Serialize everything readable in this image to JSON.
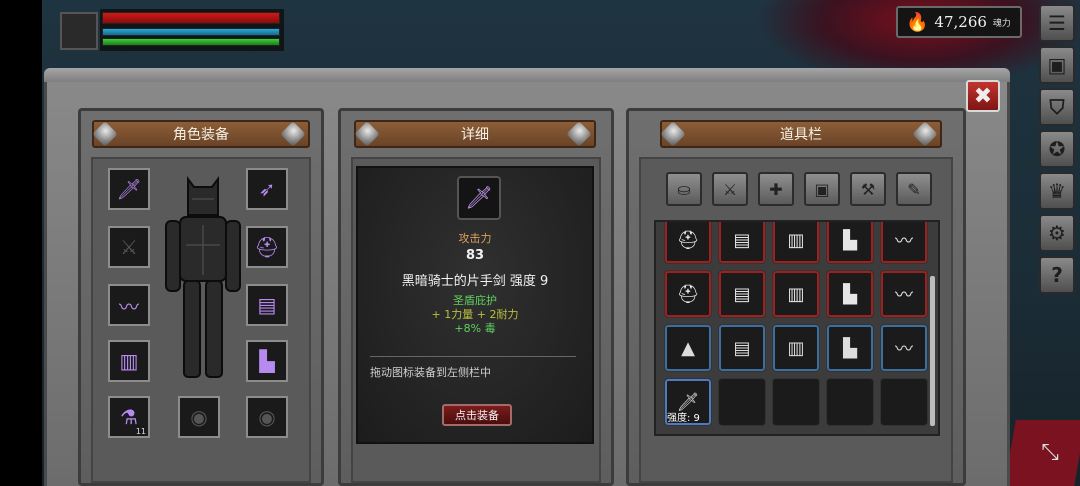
{
  "hud": {
    "souls_value": "47,266",
    "souls_unit": "魂力"
  },
  "side_menu": [
    {
      "name": "menu-list-icon",
      "glyph": "☰"
    },
    {
      "name": "backpack-icon",
      "glyph": "▣"
    },
    {
      "name": "helmet-icon",
      "glyph": "⛉"
    },
    {
      "name": "emblem-icon",
      "glyph": "✪"
    },
    {
      "name": "crown-icon",
      "glyph": "♛"
    },
    {
      "name": "settings-gear-icon",
      "glyph": "⚙"
    },
    {
      "name": "help-icon",
      "glyph": "?"
    }
  ],
  "close_label": "✖",
  "panels": {
    "equipment": {
      "title": "角色装备"
    },
    "details": {
      "title": "详细"
    },
    "inventory": {
      "title": "道具栏"
    }
  },
  "equipment_slots": {
    "left": [
      {
        "name": "equipped-sword-slot",
        "glyph": "🗡",
        "state": "purple"
      },
      {
        "name": "equipped-dagger-slot",
        "glyph": "⚔",
        "state": "empty"
      },
      {
        "name": "equipped-bracer-slot",
        "glyph": "〰",
        "state": "purple"
      },
      {
        "name": "equipped-leggings-slot",
        "glyph": "▥",
        "state": "purple"
      },
      {
        "name": "equipped-potion-slot",
        "glyph": "⚗",
        "state": "purple",
        "badge": "11"
      }
    ],
    "right": [
      {
        "name": "equipped-bow-slot",
        "glyph": "➶",
        "state": "purple"
      },
      {
        "name": "equipped-helmet-slot",
        "glyph": "⛑",
        "state": "purple"
      },
      {
        "name": "equipped-chest-slot",
        "glyph": "▤",
        "state": "purple"
      },
      {
        "name": "equipped-boots-slot",
        "glyph": "▙",
        "state": "purple"
      },
      {
        "name": "equipped-ring-slot-2",
        "glyph": "◉",
        "state": "empty"
      }
    ],
    "bottom_middle": {
      "name": "equipped-ring-slot-1",
      "glyph": "◉",
      "state": "empty"
    }
  },
  "detail": {
    "stat_label": "攻击力",
    "stat_value": "83",
    "item_name": "黑暗骑士的片手剑 强度 9",
    "set_name": "圣盾庇护",
    "bonus_line1": "+ 1力量  + 2耐力",
    "bonus_line2": "+8% 毒",
    "hint": "拖动图标装备到左侧栏中",
    "equip_button": "点击装备"
  },
  "inventory_filters": [
    {
      "name": "filter-all-basket-icon",
      "glyph": "⛀"
    },
    {
      "name": "filter-weapons-icon",
      "glyph": "⚔"
    },
    {
      "name": "filter-armor-icon",
      "glyph": "✚"
    },
    {
      "name": "filter-chest-icon",
      "glyph": "▣"
    },
    {
      "name": "filter-tools-icon",
      "glyph": "⚒"
    },
    {
      "name": "filter-misc-icon",
      "glyph": "✎"
    }
  ],
  "inventory_rows": [
    [
      {
        "glyph": "⛑",
        "state": "red"
      },
      {
        "glyph": "▤",
        "state": "red"
      },
      {
        "glyph": "▥",
        "state": "red"
      },
      {
        "glyph": "▙",
        "state": "red"
      },
      {
        "glyph": "〰",
        "state": "red"
      }
    ],
    [
      {
        "glyph": "⛑",
        "state": "red"
      },
      {
        "glyph": "▤",
        "state": "red"
      },
      {
        "glyph": "▥",
        "state": "red"
      },
      {
        "glyph": "▙",
        "state": "red"
      },
      {
        "glyph": "〰",
        "state": "red"
      }
    ],
    [
      {
        "glyph": "▲",
        "state": "blue"
      },
      {
        "glyph": "▤",
        "state": "blue"
      },
      {
        "glyph": "▥",
        "state": "blue"
      },
      {
        "glyph": "▙",
        "state": "blue"
      },
      {
        "glyph": "〰",
        "state": "blue"
      }
    ],
    [
      {
        "glyph": "🗡",
        "state": "sel",
        "sub": "强度: 9"
      },
      {
        "glyph": "",
        "state": "empty"
      },
      {
        "glyph": "",
        "state": "empty"
      },
      {
        "glyph": "",
        "state": "empty"
      },
      {
        "glyph": "",
        "state": "empty"
      }
    ]
  ]
}
